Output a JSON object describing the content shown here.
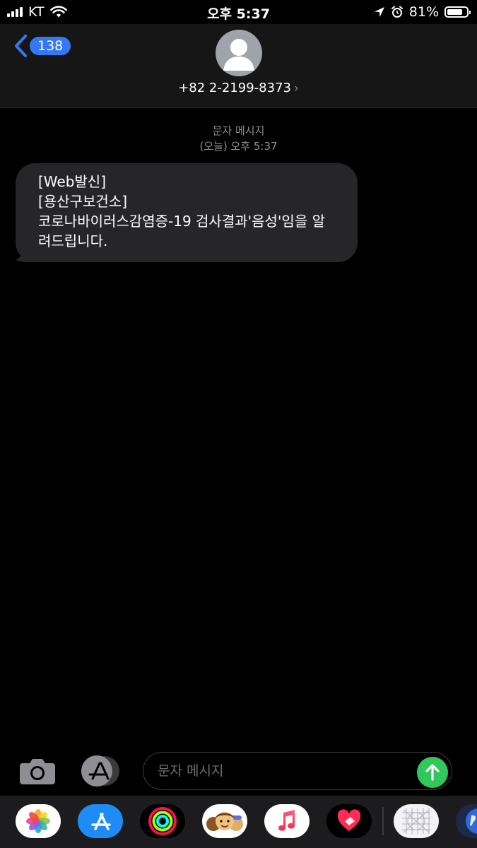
{
  "status_bar": {
    "carrier": "KT",
    "time": "오후 5:37",
    "battery": "81%",
    "battery_level": 0.81
  },
  "header": {
    "back_count": "138",
    "contact": "+82 2-2199-8373",
    "chevron": "›"
  },
  "conversation": {
    "type_label": "문자 메시지",
    "timestamp": "(오늘) 오후 5:37",
    "messages": [
      {
        "lines": [
          "[Web발신]",
          "[용산구보건소]",
          "코로나바이러스감염증-19 검사결과'음성'임을 알",
          "려드립니다."
        ]
      }
    ]
  },
  "composer": {
    "placeholder": "문자 메시지"
  },
  "app_drawer": [
    {
      "name": "photos-icon"
    },
    {
      "name": "app-store-icon"
    },
    {
      "name": "activity-icon"
    },
    {
      "name": "memoji-icon"
    },
    {
      "name": "music-icon"
    },
    {
      "name": "heart-app-icon"
    },
    {
      "name": "digital-touch-icon"
    },
    {
      "name": "globe-sticker-icon"
    }
  ],
  "colors": {
    "accent_blue": "#3478f6",
    "send_green": "#30c85a",
    "bubble_gray": "#262628"
  }
}
